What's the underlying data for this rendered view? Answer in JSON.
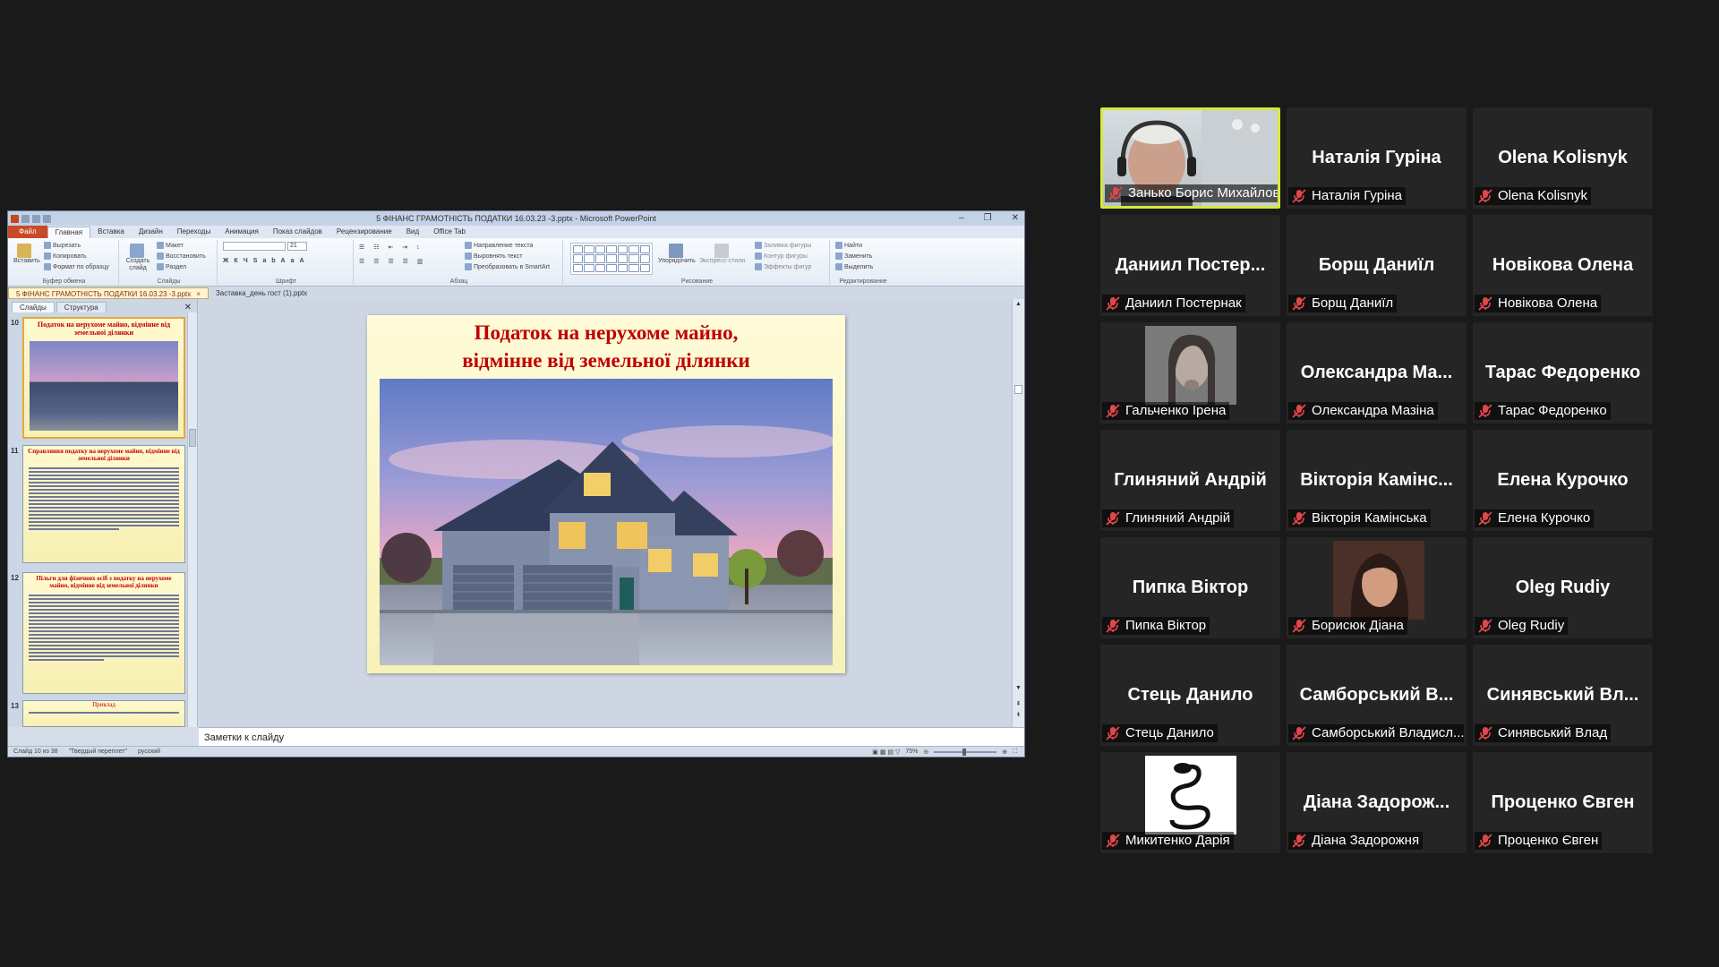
{
  "powerpoint": {
    "window_title": "5 ФІНАНС ГРАМОТНІСТЬ ПОДАТКИ 16.03.23 -3.pptx - Microsoft PowerPoint",
    "ribbon_tabs": [
      "Файл",
      "Главная",
      "Вставка",
      "Дизайн",
      "Переходы",
      "Анимация",
      "Показ слайдов",
      "Рецензирование",
      "Вид",
      "Office Tab"
    ],
    "ribbon": {
      "paste": "Вставить",
      "cut": "Вырезать",
      "copy": "Копировать",
      "format_painter": "Формат по образцу",
      "clipboard_group": "Буфер обмена",
      "new_slide": "Создать слайд",
      "layout": "Макет",
      "reset": "Восстановить",
      "section": "Раздел",
      "slides_group": "Слайды",
      "font_size": "21",
      "font_group": "Шрифт",
      "text_direction": "Направление текста",
      "align_text": "Выровнять текст",
      "smartart": "Преобразовать в SmartArt",
      "paragraph_group": "Абзац",
      "arrange": "Упорядочить",
      "quick_styles": "Экспресс-стили",
      "shape_fill": "Заливка фигуры",
      "shape_outline": "Контур фигуры",
      "shape_effects": "Эффекты фигур",
      "drawing_group": "Рисование",
      "find": "Найти",
      "replace": "Заменить",
      "select": "Выделить",
      "editing_group": "Редактирование"
    },
    "doc_tabs": [
      "5 ФІНАНС ГРАМОТНІСТЬ ПОДАТКИ 16.03.23 -3.pptx",
      "Заставка_день гост (1).pptx"
    ],
    "side_tabs": [
      "Слайды",
      "Структура"
    ],
    "thumbnails": [
      {
        "num": "10",
        "title": "Податок на нерухоме майно, відмінне від земельної ділянки"
      },
      {
        "num": "11",
        "title": "Справляння податку на нерухоме майно, відмінне від земельної ділянки"
      },
      {
        "num": "12",
        "title": "Пільги для фізичних осіб з податку на нерухоме майно, відмінне від земельної ділянки"
      },
      {
        "num": "13",
        "title": "Приклад"
      }
    ],
    "slide_title_line1": "Податок на нерухоме майно,",
    "slide_title_line2": "відмінне від земельної ділянки",
    "notes_placeholder": "Заметки к слайду",
    "status": {
      "slide_info": "Слайд 10 из 38",
      "theme": "\"Твердый переплет\"",
      "language": "русский",
      "zoom": "75%"
    }
  },
  "participants": [
    {
      "display": "",
      "label": "Занько Борис Михайлов...",
      "video": true,
      "active": true
    },
    {
      "display": "Наталія Гуріна",
      "label": "Наталія Гуріна"
    },
    {
      "display": "Olena Kolisnyk",
      "label": "Olena Kolisnyk"
    },
    {
      "display": "Даниил  Постер...",
      "label": "Даниил Постернак"
    },
    {
      "display": "Борщ Даниїл",
      "label": "Борщ Даниїл"
    },
    {
      "display": "Новікова Олена",
      "label": "Новікова Олена"
    },
    {
      "display": "",
      "label": "Гальченко Ірена",
      "video": true
    },
    {
      "display": "Олександра  Ма...",
      "label": "Олександра Мазіна"
    },
    {
      "display": "Тарас Федоренко",
      "label": "Тарас Федоренко"
    },
    {
      "display": "Глиняний  Андрій",
      "label": "Глиняний Андрій"
    },
    {
      "display": "Вікторія Камінс...",
      "label": "Вікторія Камінська"
    },
    {
      "display": "Елена Курочко",
      "label": "Елена Курочко"
    },
    {
      "display": "Пипка Віктор",
      "label": "Пипка Віктор"
    },
    {
      "display": "",
      "label": "Борисюк Діана",
      "video": true
    },
    {
      "display": "Oleg Rudiy",
      "label": "Oleg Rudiy"
    },
    {
      "display": "Стець Данило",
      "label": "Стець Данило"
    },
    {
      "display": "Самборський В...",
      "label": "Самборський Владисл..."
    },
    {
      "display": "Синявський Вл...",
      "label": "Синявський Влад"
    },
    {
      "display": "",
      "label": "Микитенко Дарія",
      "video": true
    },
    {
      "display": "Діана  Задорож...",
      "label": "Діана Задорожня"
    },
    {
      "display": "Проценко Євген",
      "label": "Проценко Євген"
    }
  ],
  "colors": {
    "active_speaker_border": "#d8e83b",
    "muted_mic": "#e0464b",
    "slide_title": "#c00000"
  }
}
